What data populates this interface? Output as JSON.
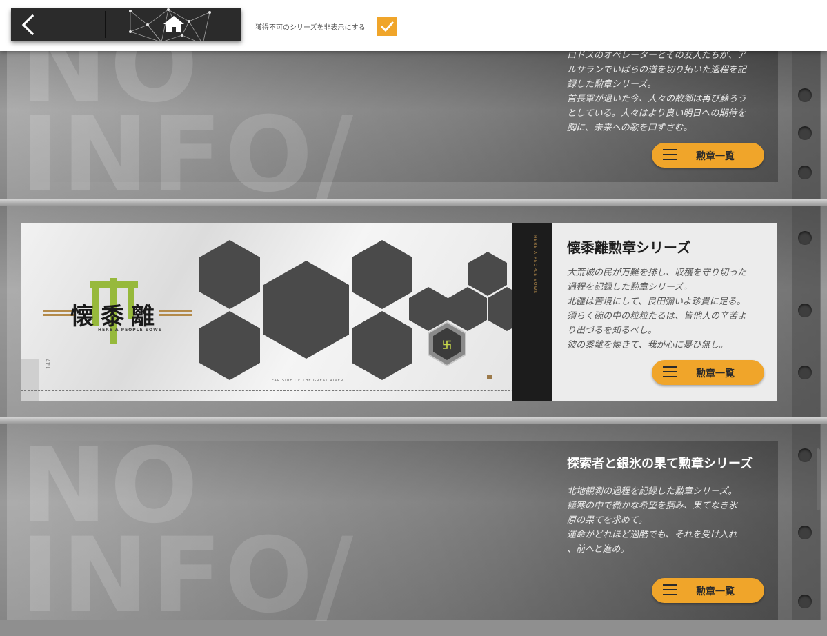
{
  "topbar": {
    "hide_unobtainable_label": "獲得不可のシリーズを非表示にする",
    "hide_unobtainable_checked": true,
    "accent": "#f0a52a"
  },
  "watermark": {
    "line1": "NO",
    "line2": "INFO/"
  },
  "cards": [
    {
      "title": "",
      "description": [
        "ロドスのオペレーターとその友人たちが、ア",
        "ルサランでいばらの道を切り拓いた過程を記",
        "録した勲章シリーズ。",
        "首長軍が退いた今、人々の故郷は再び蘇ろう",
        "としている。人々はより良い明日への期待を",
        "胸に、未来への歌を口ずさむ。"
      ],
      "button_label": "勲章一覧"
    },
    {
      "title": "懐黍離勲章シリーズ",
      "description": [
        "大荒城の民が万難を排し、収穫を守り切った",
        "過程を記録した勲章シリーズ。",
        "北疆は苦境にして、良田彌いよ珍貴に足る。",
        "須らく碗の中の粒粒たるは、皆他人の辛苦よ",
        "り出づるを知るべし。",
        "彼の黍離を懐きて、我が心に憂ひ無し。"
      ],
      "button_label": "勲章一覧",
      "banner": {
        "emblem_text": "懐黍離",
        "emblem_subtitle": "HERE A PEOPLE SOWS",
        "footer_text": "FAR SIDE OF THE GREAT RIVER",
        "side_text": "HERE A PEOPLE SOWS",
        "page_number": "147"
      }
    },
    {
      "title": "探索者と銀氷の果て勲章シリーズ",
      "description": [
        "北地観測の過程を記録した勲章シリーズ。",
        "極寒の中で微かな希望を掴み、果てなき氷",
        "原の果てを求めて。",
        "運命がどれほど過酷でも、それを受け入れ",
        "、前へと進め。"
      ],
      "button_label": "勲章一覧"
    }
  ]
}
